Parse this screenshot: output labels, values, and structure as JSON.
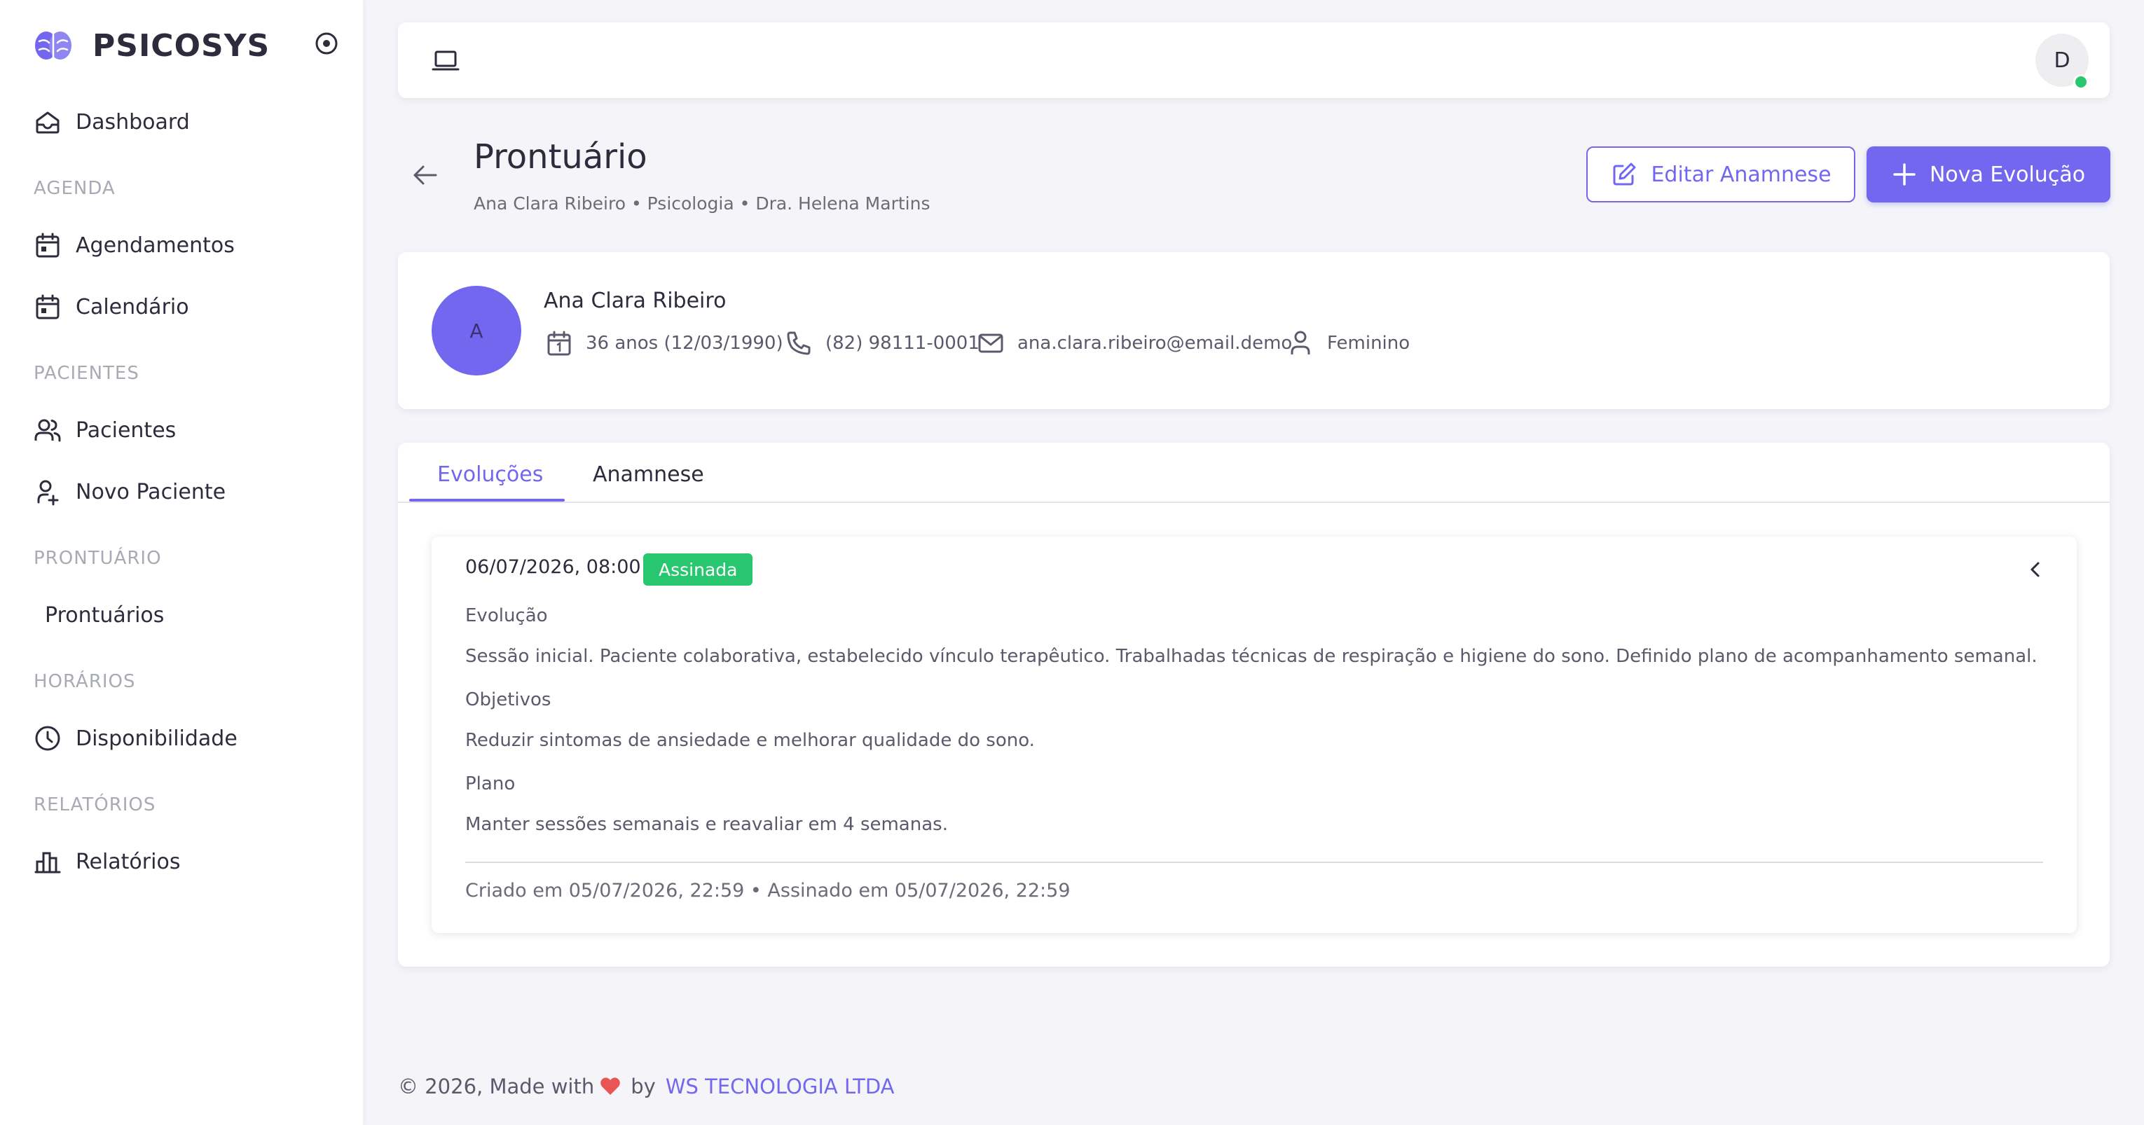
{
  "app": {
    "name": "PSICOSYS"
  },
  "sidebar": {
    "dashboard": "Dashboard",
    "sections": {
      "agenda": "AGENDA",
      "pacientes": "PACIENTES",
      "prontuario": "PRONTUÁRIO",
      "horarios": "HORÁRIOS",
      "relatorios": "RELATÓRIOS"
    },
    "items": {
      "agendamentos": "Agendamentos",
      "calendario": "Calendário",
      "pacientes": "Pacientes",
      "novo_paciente": "Novo Paciente",
      "prontuarios": "Prontuários",
      "disponibilidade": "Disponibilidade",
      "relatorios": "Relatórios"
    }
  },
  "topbar": {
    "user_initial": "D"
  },
  "page": {
    "title": "Prontuário",
    "subtitle": "Ana Clara Ribeiro • Psicologia • Dra. Helena Martins",
    "edit_button": "Editar Anamnese",
    "new_button": "Nova Evolução"
  },
  "patient": {
    "initial": "A",
    "name": "Ana Clara Ribeiro",
    "age": "36 anos (12/03/1990)",
    "phone": "(82) 98111-0001",
    "email": "ana.clara.ribeiro@email.demo",
    "gender": "Feminino"
  },
  "tabs": {
    "evolucoes": "Evoluções",
    "anamnese": "Anamnese",
    "active": "evolucoes"
  },
  "evolution": {
    "datetime": "06/07/2026, 08:00",
    "status": "Assinada",
    "evolucao_label": "Evolução",
    "evolucao_text": "Sessão inicial. Paciente colaborativa, estabelecido vínculo terapêutico. Trabalhadas técnicas de respiração e higiene do sono. Definido plano de acompanhamento semanal.",
    "objetivos_label": "Objetivos",
    "objetivos_text": "Reduzir sintomas de ansiedade e melhorar qualidade do sono.",
    "plano_label": "Plano",
    "plano_text": "Manter sessões semanais e reavaliar em 4 semanas.",
    "footer": "Criado em 05/07/2026, 22:59 • Assinado em 05/07/2026, 22:59"
  },
  "footer": {
    "prefix": "© 2026, Made with",
    "by": "by",
    "company": "WS TECNOLOGIA LTDA"
  },
  "colors": {
    "primary": "#7367f0",
    "success": "#28c76f",
    "heart": "#ea5455"
  }
}
